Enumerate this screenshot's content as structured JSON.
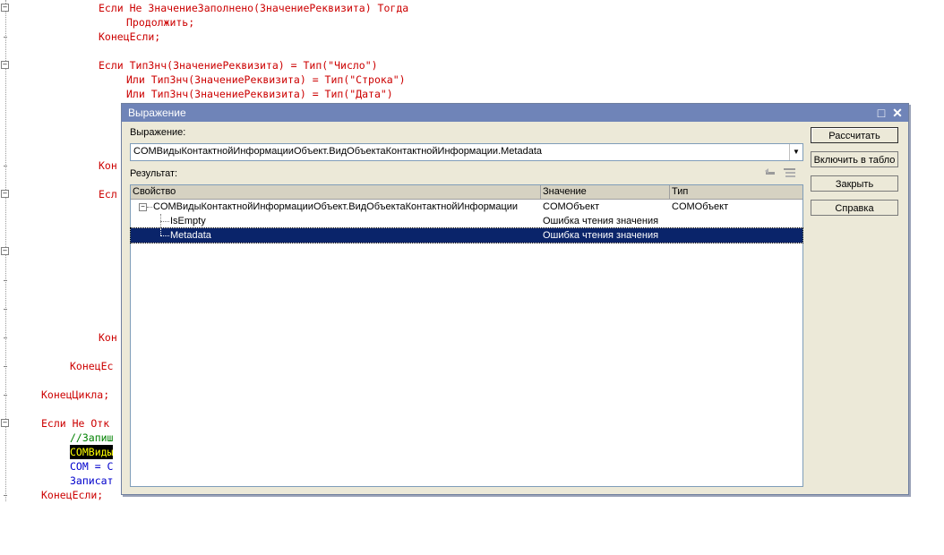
{
  "code": {
    "lines": [
      {
        "text": "Если Не ЗначениеЗаполнено(ЗначениеРеквизита) Тогда"
      },
      {
        "text": "Продолжить;"
      },
      {
        "text": "КонецЕсли;"
      },
      {
        "text": "Если ТипЗнч(ЗначениеРеквизита) = Тип(\"Число\")"
      },
      {
        "text": "Или ТипЗнч(ЗначениеРеквизита) = Тип(\"Строка\")"
      },
      {
        "text": "Или ТипЗнч(ЗначениеРеквизита) = Тип(\"Дата\")"
      },
      {
        "text": "Кон"
      },
      {
        "text": "Есл"
      },
      {
        "text": "Кон"
      },
      {
        "text": "КонецЕс"
      },
      {
        "text": "КонецЦикла;"
      },
      {
        "text": "Если Не Отк"
      },
      {
        "text": "//Запиш"
      },
      {
        "text": "COMВиды"
      },
      {
        "text": "COM = C"
      },
      {
        "text": "Записат"
      },
      {
        "text": "КонецЕсли;"
      }
    ]
  },
  "dialog": {
    "title": "Выражение",
    "expression_label": "Выражение:",
    "expression_value": "COMВидыКонтактнойИнформацииОбъект.ВидОбъектаКонтактнойИнформации.Metadata",
    "result_label": "Результат:",
    "columns": [
      "Свойство",
      "Значение",
      "Тип"
    ],
    "rows": [
      {
        "property": "COMВидыКонтактнойИнформацииОбъект.ВидОбъектаКонтактнойИнформации",
        "value": "COMОбъект",
        "type": "COMОбъект",
        "expander": "−"
      },
      {
        "property": "IsEmpty",
        "value": "Ошибка чтения значения",
        "type": ""
      },
      {
        "property": "Metadata",
        "value": "Ошибка чтения значения",
        "type": ""
      }
    ],
    "buttons": {
      "calculate": "Рассчитать",
      "add_to_table": "Включить в табло",
      "close": "Закрыть",
      "help": "Справка"
    },
    "title_icons": {
      "maximize": "□",
      "close": "✕"
    },
    "combo_arrow": "▼"
  },
  "colors": {
    "titlebar": "#6f84b8",
    "selection": "#0a246a",
    "keyword": "#cc0000"
  }
}
